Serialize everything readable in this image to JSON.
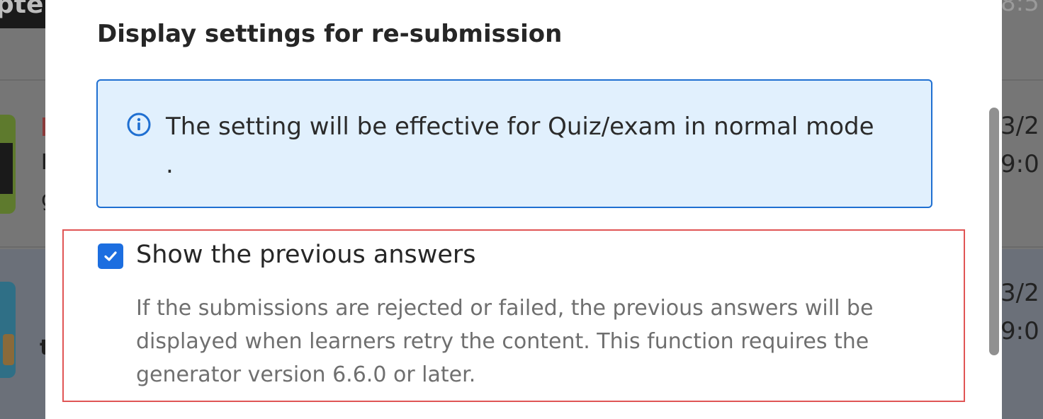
{
  "background": {
    "topbar_text": "pte",
    "row1_letters": [
      "I",
      "g"
    ],
    "row1_right": [
      "3/2",
      "9:0"
    ],
    "row2_letter": "t",
    "row2_right": [
      "3/2",
      "9:0"
    ],
    "top_right": "8:5"
  },
  "modal": {
    "title": "Display settings for re-submission",
    "info": {
      "icon": "info-circle-icon",
      "text": "The setting will be effective for Quiz/exam in normal mode ."
    },
    "option": {
      "checked": true,
      "label": "Show the previous answers",
      "description": "If the submissions are rejected or failed, the previous answers will be displayed when learners retry the content. This function requires the generator version 6.6.0 or later."
    }
  },
  "colors": {
    "accent": "#1c6ee0",
    "info_bg": "#e1f0fd",
    "info_border": "#1f6fd1",
    "highlight_border": "#e05555"
  }
}
